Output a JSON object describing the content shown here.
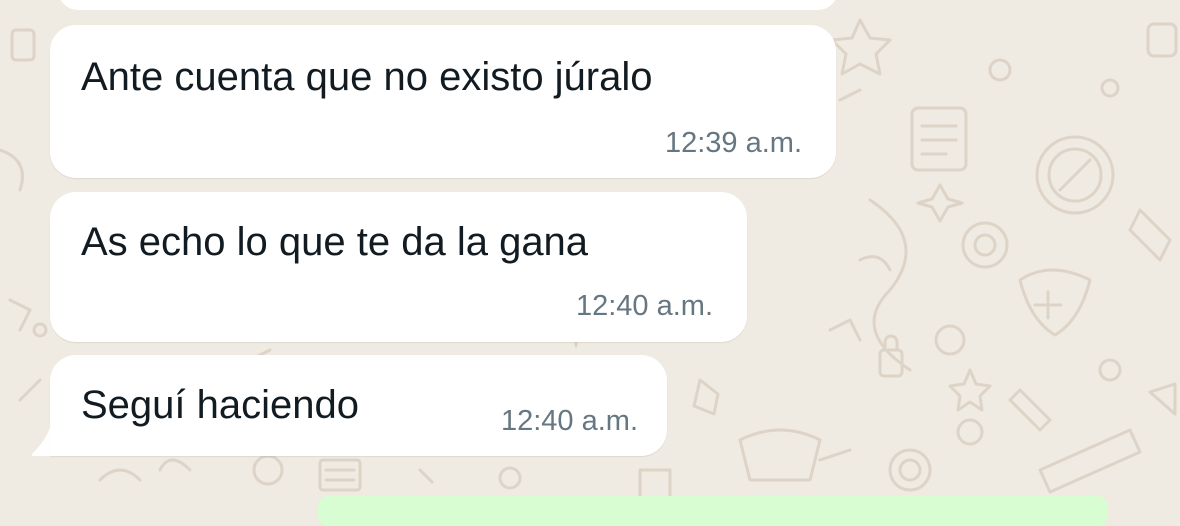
{
  "chat": {
    "messages": [
      {
        "text": "Ante cuenta que no existo júralo",
        "time": "12:39 a.m."
      },
      {
        "text": "As echo lo que te da la gana",
        "time": "12:40 a.m."
      },
      {
        "text": "Seguí haciendo",
        "time": "12:40 a.m."
      }
    ]
  },
  "colors": {
    "chat_background": "#efeae2",
    "incoming_bubble": "#ffffff",
    "outgoing_bubble": "#d9fdd3",
    "message_text": "#111b21",
    "timestamp_text": "#667781"
  }
}
